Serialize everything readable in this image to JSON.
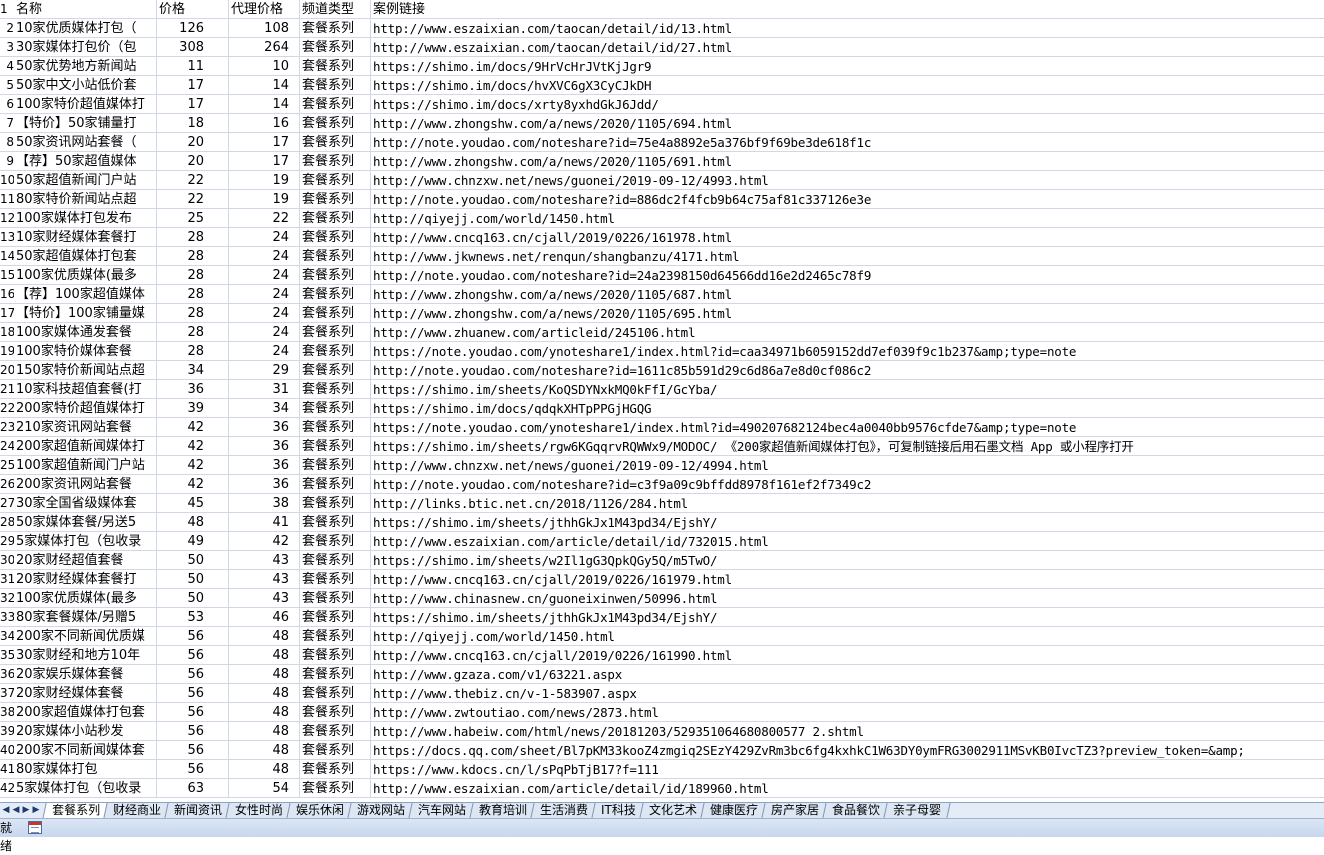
{
  "headers": {
    "row": "1",
    "name": "名称",
    "price": "价格",
    "agent_price": "代理价格",
    "channel_type": "频道类型",
    "link": "案例链接"
  },
  "rows": [
    {
      "rn": "2",
      "name": "10家优质媒体打包（",
      "price": "126",
      "agent": "108",
      "type": "套餐系列",
      "link": "http://www.eszaixian.com/taocan/detail/id/13.html"
    },
    {
      "rn": "3",
      "name": "30家媒体打包价（包",
      "price": "308",
      "agent": "264",
      "type": "套餐系列",
      "link": "http://www.eszaixian.com/taocan/detail/id/27.html"
    },
    {
      "rn": "4",
      "name": "50家优势地方新闻站",
      "price": "11",
      "agent": "10",
      "type": "套餐系列",
      "link": "https://shimo.im/docs/9HrVcHrJVtKjJgr9"
    },
    {
      "rn": "5",
      "name": "50家中文小站低价套",
      "price": "17",
      "agent": "14",
      "type": "套餐系列",
      "link": "https://shimo.im/docs/hvXVC6gX3CyCJkDH"
    },
    {
      "rn": "6",
      "name": "100家特价超值媒体打",
      "price": "17",
      "agent": "14",
      "type": "套餐系列",
      "link": "https://shimo.im/docs/xrty8yxhdGkJ6Jdd/"
    },
    {
      "rn": "7",
      "name": "【特价】50家铺量打",
      "price": "18",
      "agent": "16",
      "type": "套餐系列",
      "link": "http://www.zhongshw.com/a/news/2020/1105/694.html"
    },
    {
      "rn": "8",
      "name": "50家资讯网站套餐（",
      "price": "20",
      "agent": "17",
      "type": "套餐系列",
      "link": "http://note.youdao.com/noteshare?id=75e4a8892e5a376bf9f69be3de618f1c"
    },
    {
      "rn": "9",
      "name": "【荐】50家超值媒体",
      "price": "20",
      "agent": "17",
      "type": "套餐系列",
      "link": "http://www.zhongshw.com/a/news/2020/1105/691.html"
    },
    {
      "rn": "10",
      "name": "50家超值新闻门户站",
      "price": "22",
      "agent": "19",
      "type": "套餐系列",
      "link": "http://www.chnzxw.net/news/guonei/2019-09-12/4993.html"
    },
    {
      "rn": "11",
      "name": "80家特价新闻站点超",
      "price": "22",
      "agent": "19",
      "type": "套餐系列",
      "link": "http://note.youdao.com/noteshare?id=886dc2f4fcb9b64c75af81c337126e3e"
    },
    {
      "rn": "12",
      "name": "100家媒体打包发布",
      "price": "25",
      "agent": "22",
      "type": "套餐系列",
      "link": "http://qiyejj.com/world/1450.html"
    },
    {
      "rn": "13",
      "name": "10家财经媒体套餐打",
      "price": "28",
      "agent": "24",
      "type": "套餐系列",
      "link": "http://www.cncq163.cn/cjall/2019/0226/161978.html"
    },
    {
      "rn": "14",
      "name": "50家超值媒体打包套",
      "price": "28",
      "agent": "24",
      "type": "套餐系列",
      "link": "http://www.jkwnews.net/renqun/shangbanzu/4171.html"
    },
    {
      "rn": "15",
      "name": "100家优质媒体(最多",
      "price": "28",
      "agent": "24",
      "type": "套餐系列",
      "link": "http://note.youdao.com/noteshare?id=24a2398150d64566dd16e2d2465c78f9"
    },
    {
      "rn": "16",
      "name": "【荐】100家超值媒体",
      "price": "28",
      "agent": "24",
      "type": "套餐系列",
      "link": "http://www.zhongshw.com/a/news/2020/1105/687.html"
    },
    {
      "rn": "17",
      "name": "【特价】100家铺量媒",
      "price": "28",
      "agent": "24",
      "type": "套餐系列",
      "link": "http://www.zhongshw.com/a/news/2020/1105/695.html"
    },
    {
      "rn": "18",
      "name": "100家媒体通发套餐",
      "price": "28",
      "agent": "24",
      "type": "套餐系列",
      "link": "http://www.zhuanew.com/articleid/245106.html"
    },
    {
      "rn": "19",
      "name": "100家特价媒体套餐",
      "price": "28",
      "agent": "24",
      "type": "套餐系列",
      "link": "https://note.youdao.com/ynoteshare1/index.html?id=caa34971b6059152dd7ef039f9c1b237&amp;type=note"
    },
    {
      "rn": "20",
      "name": "150家特价新闻站点超",
      "price": "34",
      "agent": "29",
      "type": "套餐系列",
      "link": "http://note.youdao.com/noteshare?id=1611c85b591d29c6d86a7e8d0cf086c2"
    },
    {
      "rn": "21",
      "name": "10家科技超值套餐(打",
      "price": "36",
      "agent": "31",
      "type": "套餐系列",
      "link": "https://shimo.im/sheets/KoQSDYNxkMQ0kFfI/GcYba/"
    },
    {
      "rn": "22",
      "name": "200家特价超值媒体打",
      "price": "39",
      "agent": "34",
      "type": "套餐系列",
      "link": "https://shimo.im/docs/qdqkXHTpPPGjHGQG"
    },
    {
      "rn": "23",
      "name": "210家资讯网站套餐",
      "price": "42",
      "agent": "36",
      "type": "套餐系列",
      "link": "https://note.youdao.com/ynoteshare1/index.html?id=490207682124bec4a0040bb9576cfde7&amp;type=note"
    },
    {
      "rn": "24",
      "name": "200家超值新闻媒体打",
      "price": "42",
      "agent": "36",
      "type": "套餐系列",
      "link": "https://shimo.im/sheets/rgw6KGqqrvRQWWx9/MODOC/ 《200家超值新闻媒体打包》，可复制链接后用石墨文档 App 或小程序打开"
    },
    {
      "rn": "25",
      "name": "100家超值新闻门户站",
      "price": "42",
      "agent": "36",
      "type": "套餐系列",
      "link": "http://www.chnzxw.net/news/guonei/2019-09-12/4994.html"
    },
    {
      "rn": "26",
      "name": "200家资讯网站套餐",
      "price": "42",
      "agent": "36",
      "type": "套餐系列",
      "link": "http://note.youdao.com/noteshare?id=c3f9a09c9bffdd8978f161ef2f7349c2"
    },
    {
      "rn": "27",
      "name": "30家全国省级媒体套",
      "price": "45",
      "agent": "38",
      "type": "套餐系列",
      "link": "http://links.btic.net.cn/2018/1126/284.html"
    },
    {
      "rn": "28",
      "name": "50家媒体套餐/另送5",
      "price": "48",
      "agent": "41",
      "type": "套餐系列",
      "link": "https://shimo.im/sheets/jthhGkJx1M43pd34/EjshY/"
    },
    {
      "rn": "29",
      "name": "5家媒体打包（包收录",
      "price": "49",
      "agent": "42",
      "type": "套餐系列",
      "link": "http://www.eszaixian.com/article/detail/id/732015.html"
    },
    {
      "rn": "30",
      "name": "20家财经超值套餐",
      "price": "50",
      "agent": "43",
      "type": "套餐系列",
      "link": "https://shimo.im/sheets/w2Il1gG3QpkQGy5Q/m5TwO/"
    },
    {
      "rn": "31",
      "name": "20家财经媒体套餐打",
      "price": "50",
      "agent": "43",
      "type": "套餐系列",
      "link": "http://www.cncq163.cn/cjall/2019/0226/161979.html"
    },
    {
      "rn": "32",
      "name": "100家优质媒体(最多",
      "price": "50",
      "agent": "43",
      "type": "套餐系列",
      "link": "http://www.chinasnew.cn/guoneixinwen/50996.html"
    },
    {
      "rn": "33",
      "name": "80家套餐媒体/另赠5",
      "price": "53",
      "agent": "46",
      "type": "套餐系列",
      "link": "https://shimo.im/sheets/jthhGkJx1M43pd34/EjshY/"
    },
    {
      "rn": "34",
      "name": "200家不同新闻优质媒",
      "price": "56",
      "agent": "48",
      "type": "套餐系列",
      "link": "http://qiyejj.com/world/1450.html"
    },
    {
      "rn": "35",
      "name": "30家财经和地方10年",
      "price": "56",
      "agent": "48",
      "type": "套餐系列",
      "link": "http://www.cncq163.cn/cjall/2019/0226/161990.html"
    },
    {
      "rn": "36",
      "name": "20家娱乐媒体套餐",
      "price": "56",
      "agent": "48",
      "type": "套餐系列",
      "link": "http://www.gzaza.com/v1/63221.aspx"
    },
    {
      "rn": "37",
      "name": "20家财经媒体套餐",
      "price": "56",
      "agent": "48",
      "type": "套餐系列",
      "link": "http://www.thebiz.cn/v-1-583907.aspx"
    },
    {
      "rn": "38",
      "name": "200家超值媒体打包套",
      "price": "56",
      "agent": "48",
      "type": "套餐系列",
      "link": "http://www.zwtoutiao.com/news/2873.html"
    },
    {
      "rn": "39",
      "name": "20家媒体小站秒发",
      "price": "56",
      "agent": "48",
      "type": "套餐系列",
      "link": "http://www.habeiw.com/html/news/20181203/529351064680800577 2.shtml"
    },
    {
      "rn": "40",
      "name": "200家不同新闻媒体套",
      "price": "56",
      "agent": "48",
      "type": "套餐系列",
      "link": "https://docs.qq.com/sheet/Bl7pKM33kooZ4zmgiq2SEzY429ZvRm3bc6fg4kxhkC1W63DY0ymFRG3002911MSvKB0IvcTZ3?preview_token=&amp;"
    },
    {
      "rn": "41",
      "name": "80家媒体打包",
      "price": "56",
      "agent": "48",
      "type": "套餐系列",
      "link": "https://www.kdocs.cn/l/sPqPbTjB17?f=111"
    },
    {
      "rn": "42",
      "name": "5家媒体打包（包收录",
      "price": "63",
      "agent": "54",
      "type": "套餐系列",
      "link": "http://www.eszaixian.com/article/detail/id/189960.html"
    }
  ],
  "tabs": [
    "套餐系列",
    "财经商业",
    "新闻资讯",
    "女性时尚",
    "娱乐休闲",
    "游戏网站",
    "汽车网站",
    "教育培训",
    "生活消费",
    "IT科技",
    "文化艺术",
    "健康医疗",
    "房产家居",
    "食品餐饮",
    "亲子母婴"
  ],
  "active_tab": 0,
  "nav_icons": [
    "first-sheet-icon",
    "prev-sheet-icon",
    "next-sheet-icon",
    "last-sheet-icon"
  ],
  "status": {
    "text": "就绪"
  }
}
